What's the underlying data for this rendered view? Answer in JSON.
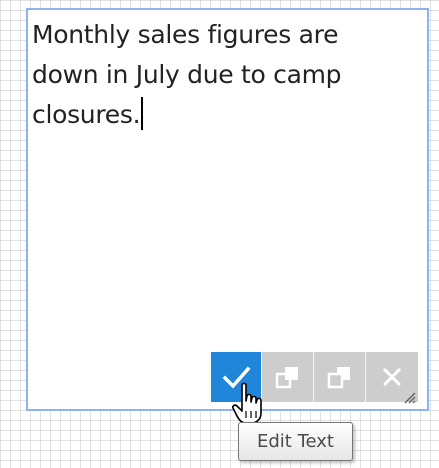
{
  "editor": {
    "text": "Monthly sales figures are down in July due to camp closures."
  },
  "toolbar": {
    "buttons": [
      {
        "name": "confirm",
        "icon": "checkmark-icon"
      },
      {
        "name": "bring-forward",
        "icon": "bring-forward-icon"
      },
      {
        "name": "send-backward",
        "icon": "send-backward-icon"
      },
      {
        "name": "delete",
        "icon": "close-icon"
      }
    ]
  },
  "tooltip": {
    "text": "Edit Text"
  },
  "colors": {
    "selection_border": "#8db2ee",
    "confirm_button": "#1f86d9",
    "disabled_button": "#cdcdcd"
  }
}
